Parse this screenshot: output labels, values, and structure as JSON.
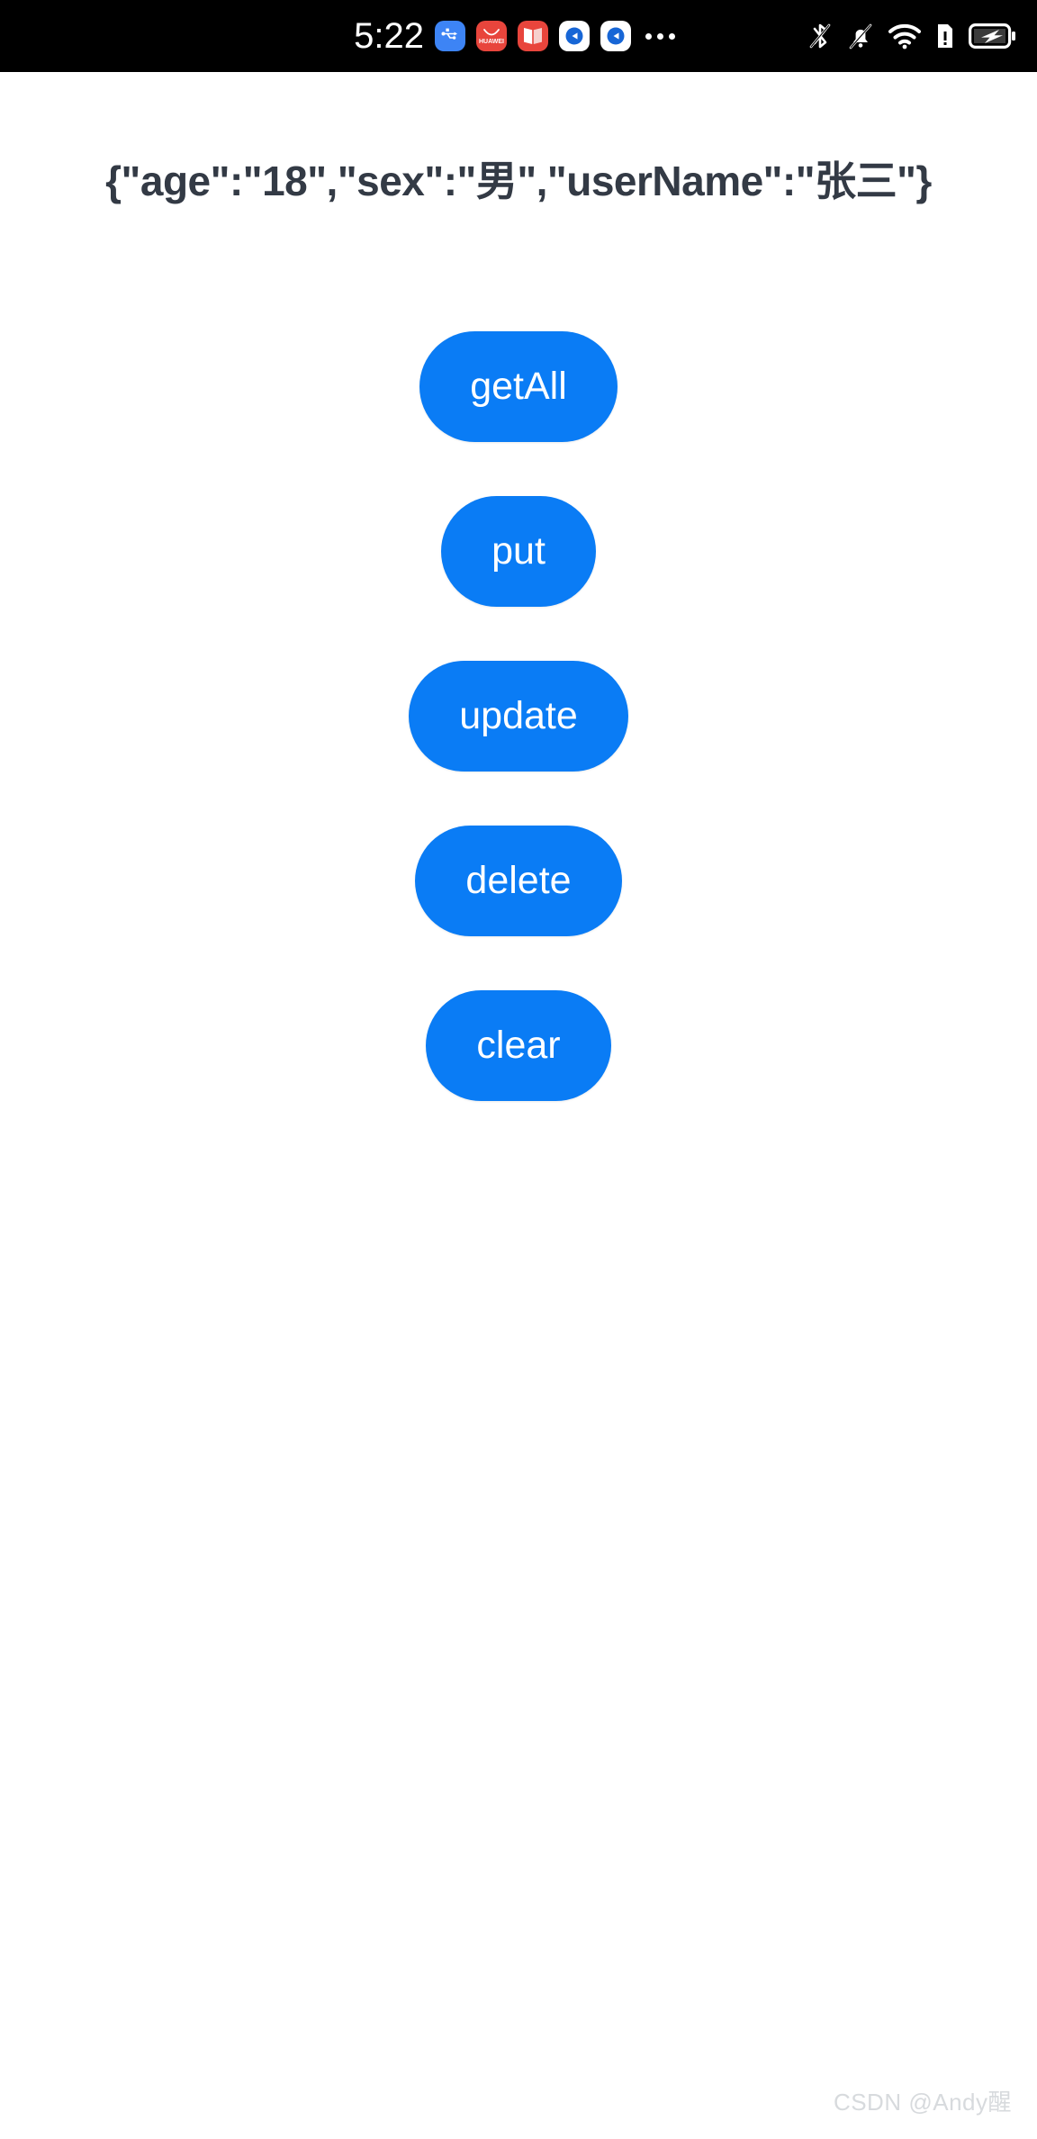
{
  "status_bar": {
    "background": "#000000",
    "clock": "5:22",
    "tray_icons": [
      {
        "name": "usb-icon",
        "label": "USB",
        "color": "#3d84f5"
      },
      {
        "name": "huawei-app-icon",
        "label": "HUAWEI",
        "color": "#e8453c"
      },
      {
        "name": "book-app-icon",
        "label": "Book",
        "color": "#e8453c"
      },
      {
        "name": "app-icon-1",
        "label": "App",
        "color": "#ffffff"
      },
      {
        "name": "app-icon-2",
        "label": "App",
        "color": "#ffffff"
      }
    ],
    "overflow_label": "More icons",
    "system_icons": [
      {
        "name": "bluetooth-off-icon",
        "label": "Bluetooth disabled"
      },
      {
        "name": "ringer-muted-icon",
        "label": "Silent mode"
      },
      {
        "name": "wifi-icon",
        "label": "Wi-Fi connected"
      },
      {
        "name": "sim-alert-icon",
        "label": "SIM alert"
      },
      {
        "name": "battery-charging-icon",
        "label": "Battery charging"
      }
    ]
  },
  "main": {
    "result_text": "{\"age\":\"18\",\"sex\":\"男\",\"userName\":\"张三\"}",
    "accent_color": "#0a7cf5",
    "buttons": [
      {
        "name": "get-all-button",
        "label": "getAll"
      },
      {
        "name": "put-button",
        "label": "put"
      },
      {
        "name": "update-button",
        "label": "update"
      },
      {
        "name": "delete-button",
        "label": "delete"
      },
      {
        "name": "clear-button",
        "label": "clear"
      }
    ]
  },
  "watermark": {
    "text": "CSDN @Andy醒",
    "color": "#d7dadd"
  }
}
